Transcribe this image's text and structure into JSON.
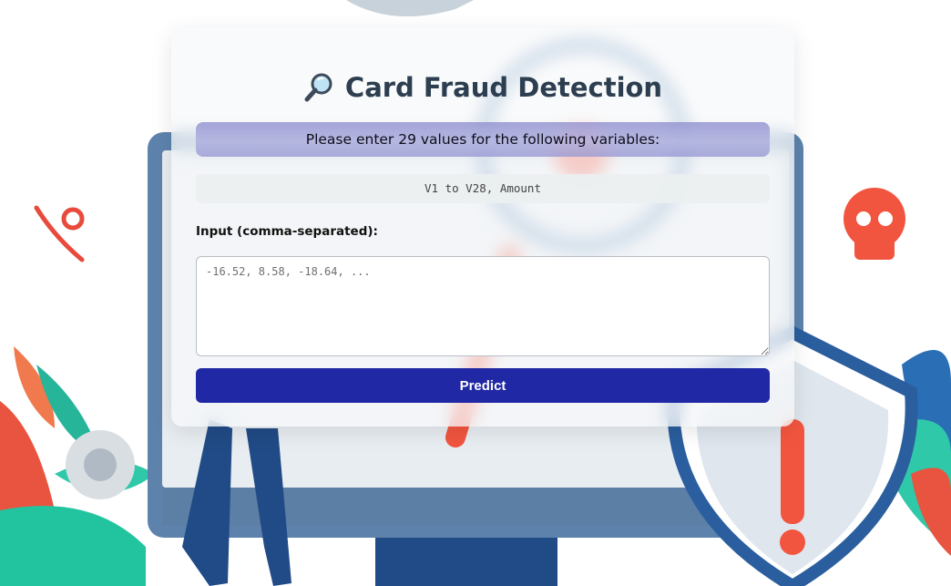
{
  "page": {
    "title": "Card Fraud Detection",
    "title_icon": "magnifying-glass-icon",
    "instruction": "Please enter 29 values for the following variables:",
    "variables": "V1 to V28, Amount",
    "input_label": "Input (comma-separated):",
    "input_placeholder": "-16.52, 8.58, -18.64, ...",
    "input_value": "",
    "predict_label": "Predict"
  },
  "colors": {
    "title": "#2c3e50",
    "banner": "#a9a9dc",
    "button": "#2128a5",
    "background_accent_red": "#f2553f",
    "background_accent_teal": "#2fc8a8",
    "background_accent_blue": "#2a5e9e"
  },
  "background": {
    "illustration": "fraud-detection-illustration",
    "icons": [
      "monitor-icon",
      "magnifier-icon",
      "skull-icon",
      "shield-warning-icon",
      "gear-icon",
      "leaf-icon",
      "hook-icon"
    ]
  }
}
